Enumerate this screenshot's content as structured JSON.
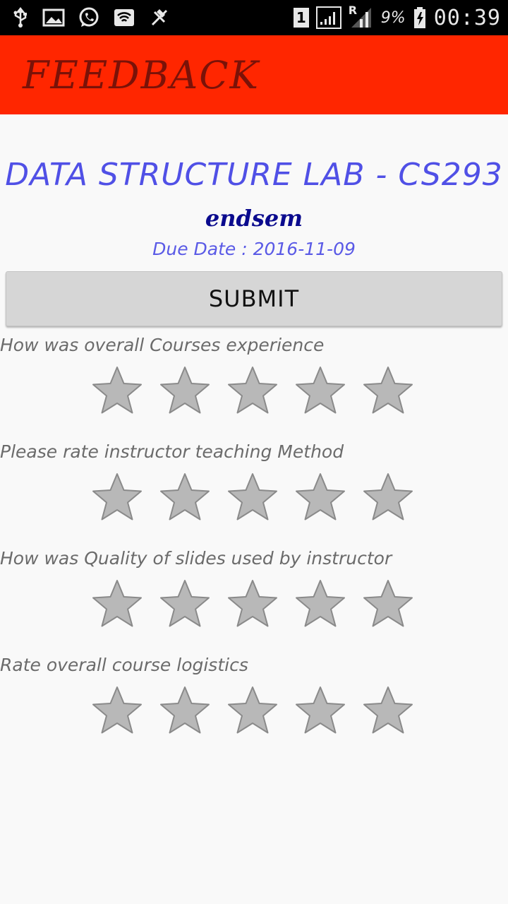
{
  "status_bar": {
    "icons": [
      "usb-icon",
      "image-icon",
      "whatsapp-icon",
      "wifi-icon",
      "no-sim-icon"
    ],
    "sim_slot": "1",
    "roaming": "R",
    "battery": "9%",
    "clock": "00:39"
  },
  "app_bar": {
    "title": "FEEDBACK"
  },
  "course": {
    "title": "DATA STRUCTURE LAB - CS293",
    "exam": "endsem",
    "due_label": "Due Date : ",
    "due_date": "2016-11-09"
  },
  "submit_label": "SUBMIT",
  "colors": {
    "app_bar": "#ff2600",
    "app_title": "#7a1208",
    "course_title": "#5050e6",
    "star_fill": "#b8b8b8",
    "star_stroke": "#8a8a8a"
  },
  "questions": [
    {
      "label": "How was overall Courses experience",
      "rating": 0,
      "max_stars": 5
    },
    {
      "label": "Please rate instructor teaching Method",
      "rating": 0,
      "max_stars": 5
    },
    {
      "label": "How was Quality of slides used by instructor",
      "rating": 0,
      "max_stars": 5
    },
    {
      "label": "Rate overall course logistics",
      "rating": 0,
      "max_stars": 5
    }
  ]
}
